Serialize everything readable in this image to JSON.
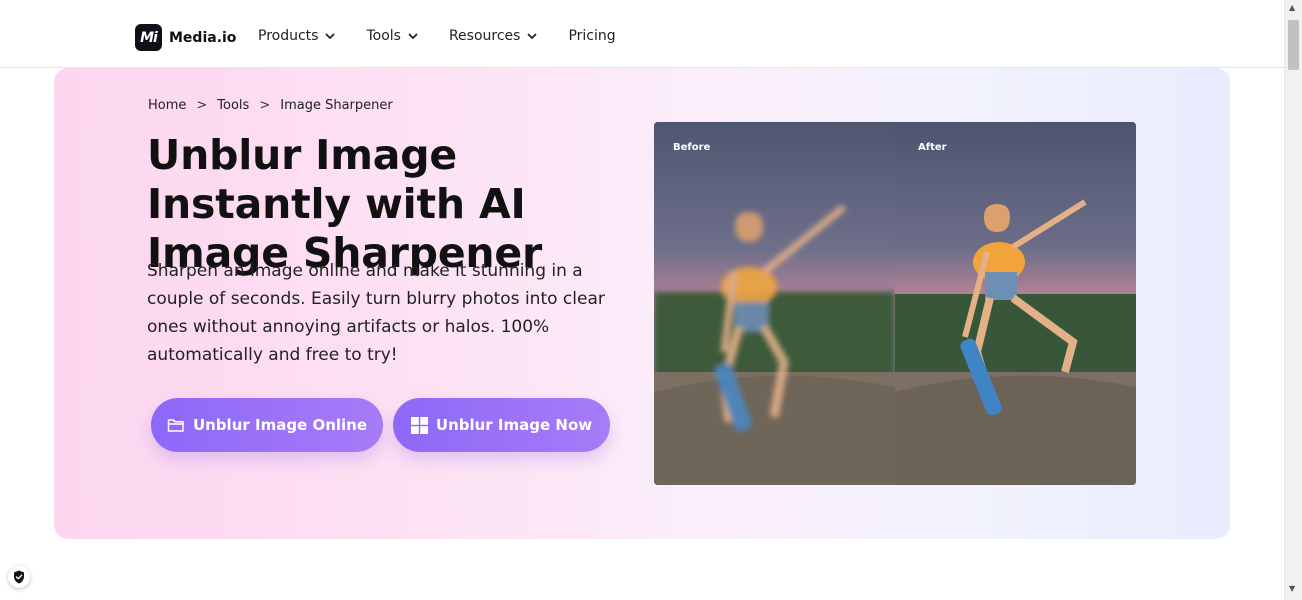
{
  "header": {
    "brand": "Media.io",
    "logo_mark": "Mi",
    "nav": [
      {
        "label": "Products",
        "has_dropdown": true
      },
      {
        "label": "Tools",
        "has_dropdown": true
      },
      {
        "label": "Resources",
        "has_dropdown": true
      },
      {
        "label": "Pricing",
        "has_dropdown": false
      }
    ]
  },
  "breadcrumb": {
    "items": [
      "Home",
      "Tools",
      "Image Sharpener"
    ],
    "separator": ">"
  },
  "hero": {
    "title": "Unblur Image Instantly with AI Image Sharpener",
    "description": "Sharpen an image online and make it stunning in a couple of seconds. Easily turn blurry photos into clear ones without annoying artifacts or halos. 100% automatically and free to try!",
    "buttons": {
      "online": {
        "label": "Unblur Image Online",
        "icon": "folder-icon"
      },
      "now": {
        "label": "Unblur Image Now",
        "icon": "windows-icon"
      }
    },
    "compare": {
      "before_label": "Before",
      "after_label": "After"
    }
  },
  "colors": {
    "accent": "#9470f7",
    "hero_gradient_start": "#fcd6ef",
    "hero_gradient_end": "#e9ecfd"
  }
}
